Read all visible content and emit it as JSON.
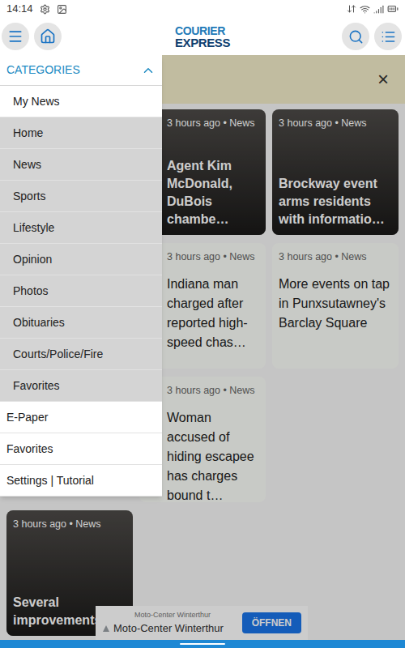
{
  "status_bar": {
    "time": "14:14"
  },
  "app_bar": {
    "logo": {
      "line1": "COURIER",
      "line2": "EXPRESS"
    }
  },
  "banner": {
    "close": "×"
  },
  "drawer": {
    "header": {
      "label": "CATEGORIES",
      "expanded": true
    },
    "items": [
      {
        "label": "My News",
        "kind": "category",
        "shaded": false
      },
      {
        "label": "Home",
        "kind": "category",
        "shaded": true
      },
      {
        "label": "News",
        "kind": "category",
        "shaded": true
      },
      {
        "label": "Sports",
        "kind": "category",
        "shaded": true
      },
      {
        "label": "Lifestyle",
        "kind": "category",
        "shaded": true
      },
      {
        "label": "Opinion",
        "kind": "category",
        "shaded": true
      },
      {
        "label": "Photos",
        "kind": "category",
        "shaded": true
      },
      {
        "label": "Obituaries",
        "kind": "category",
        "shaded": true
      },
      {
        "label": "Courts/Police/Fire",
        "kind": "category",
        "shaded": true
      },
      {
        "label": "Favorites",
        "kind": "category",
        "shaded": true
      },
      {
        "label": "E-Paper",
        "kind": "main",
        "shaded": false
      },
      {
        "label": "Favorites",
        "kind": "main",
        "shaded": false
      },
      {
        "label": "Settings | Tutorial",
        "kind": "main",
        "shaded": false
      }
    ]
  },
  "cards": [
    {
      "kind": "empty"
    },
    {
      "kind": "photo",
      "meta": "3 hours ago • News",
      "title": "Agent Kim McDonald, DuBois chambe…"
    },
    {
      "kind": "photo",
      "meta": "3 hours ago • News",
      "title": "Brockway event arms residents with informatio…"
    },
    {
      "kind": "empty"
    },
    {
      "kind": "text",
      "meta": "3 hours ago • News",
      "title": "Indiana man charged after reported high-speed chas…"
    },
    {
      "kind": "text",
      "meta": "3 hours ago • News",
      "title": "More events on tap in Punxsutawney's Barclay Square"
    },
    {
      "kind": "empty"
    },
    {
      "kind": "text",
      "meta": "3 hours ago • News",
      "title": "Woman accused of hiding escapee has charges bound t…"
    },
    {
      "kind": "empty"
    },
    {
      "kind": "photo",
      "meta": "3 hours ago • News",
      "title": "Several improvements"
    }
  ],
  "ad": {
    "label": "Moto-Center Winterthur",
    "title": "Moto-Center Winterthur",
    "button": "ÖFFNEN"
  }
}
